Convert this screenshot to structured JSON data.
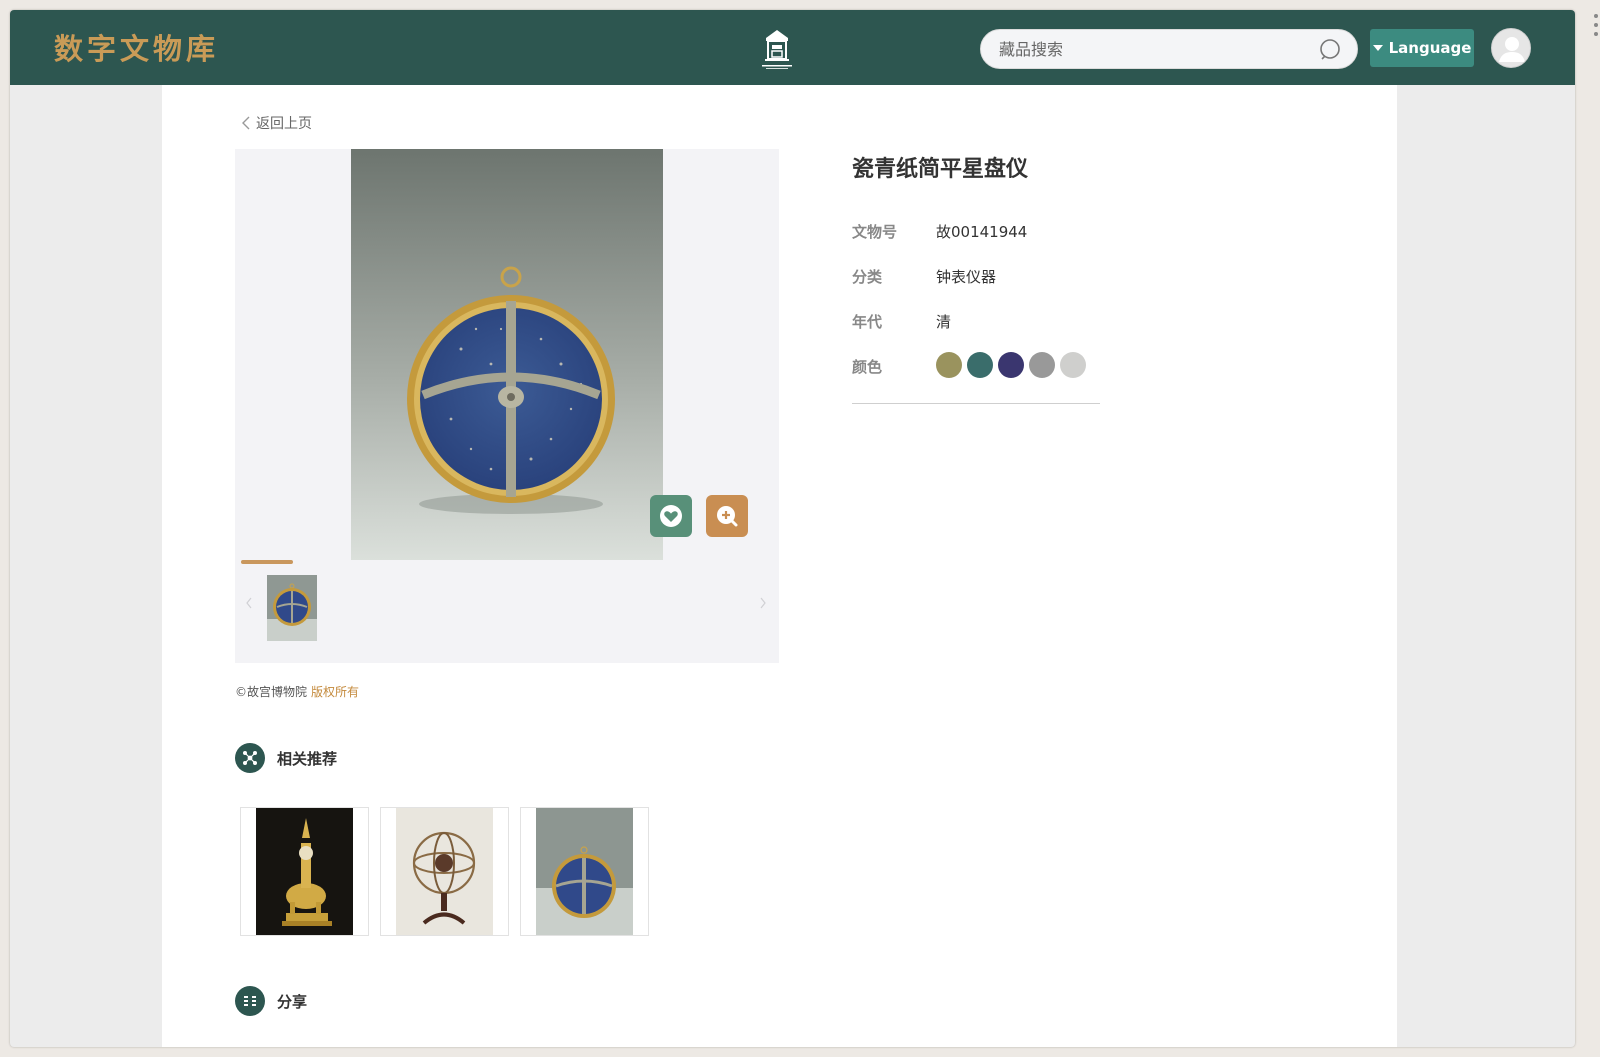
{
  "header": {
    "brand": "数字文物库",
    "search_placeholder": "藏品搜索",
    "language_label": "Language"
  },
  "nav": {
    "back_label": "返回上页"
  },
  "artifact": {
    "title": "瓷青纸简平星盘仪",
    "fields": [
      {
        "label": "文物号",
        "value": "故00141944"
      },
      {
        "label": "分类",
        "value": "钟表仪器"
      },
      {
        "label": "年代",
        "value": "清"
      },
      {
        "label": "颜色",
        "value": ""
      }
    ],
    "colors": [
      "#9a935e",
      "#3a6d6b",
      "#3a366f",
      "#999999",
      "#cfcfcd"
    ]
  },
  "gallery": {
    "image_count": 1,
    "current_index": 1
  },
  "copyright": {
    "owner": "©故宫博物院",
    "rights": "版权所有"
  },
  "related": {
    "title": "相关推荐",
    "items": [
      {
        "name": "gilded-elephant-clock"
      },
      {
        "name": "armillary-sphere"
      },
      {
        "name": "planisphere-astrolabe"
      }
    ]
  },
  "share": {
    "title": "分享"
  },
  "icons": {
    "search": "search-icon",
    "language": "caret-down-icon",
    "avatar": "user-icon",
    "back": "chevron-left-icon",
    "favorite": "heart-icon",
    "zoom": "zoom-in-icon",
    "related": "nodes-icon",
    "share": "share-icon"
  },
  "theme": {
    "primary": "#2d5650",
    "accent": "#c9975d",
    "favorite": "#589079",
    "zoom": "#c98e52"
  }
}
